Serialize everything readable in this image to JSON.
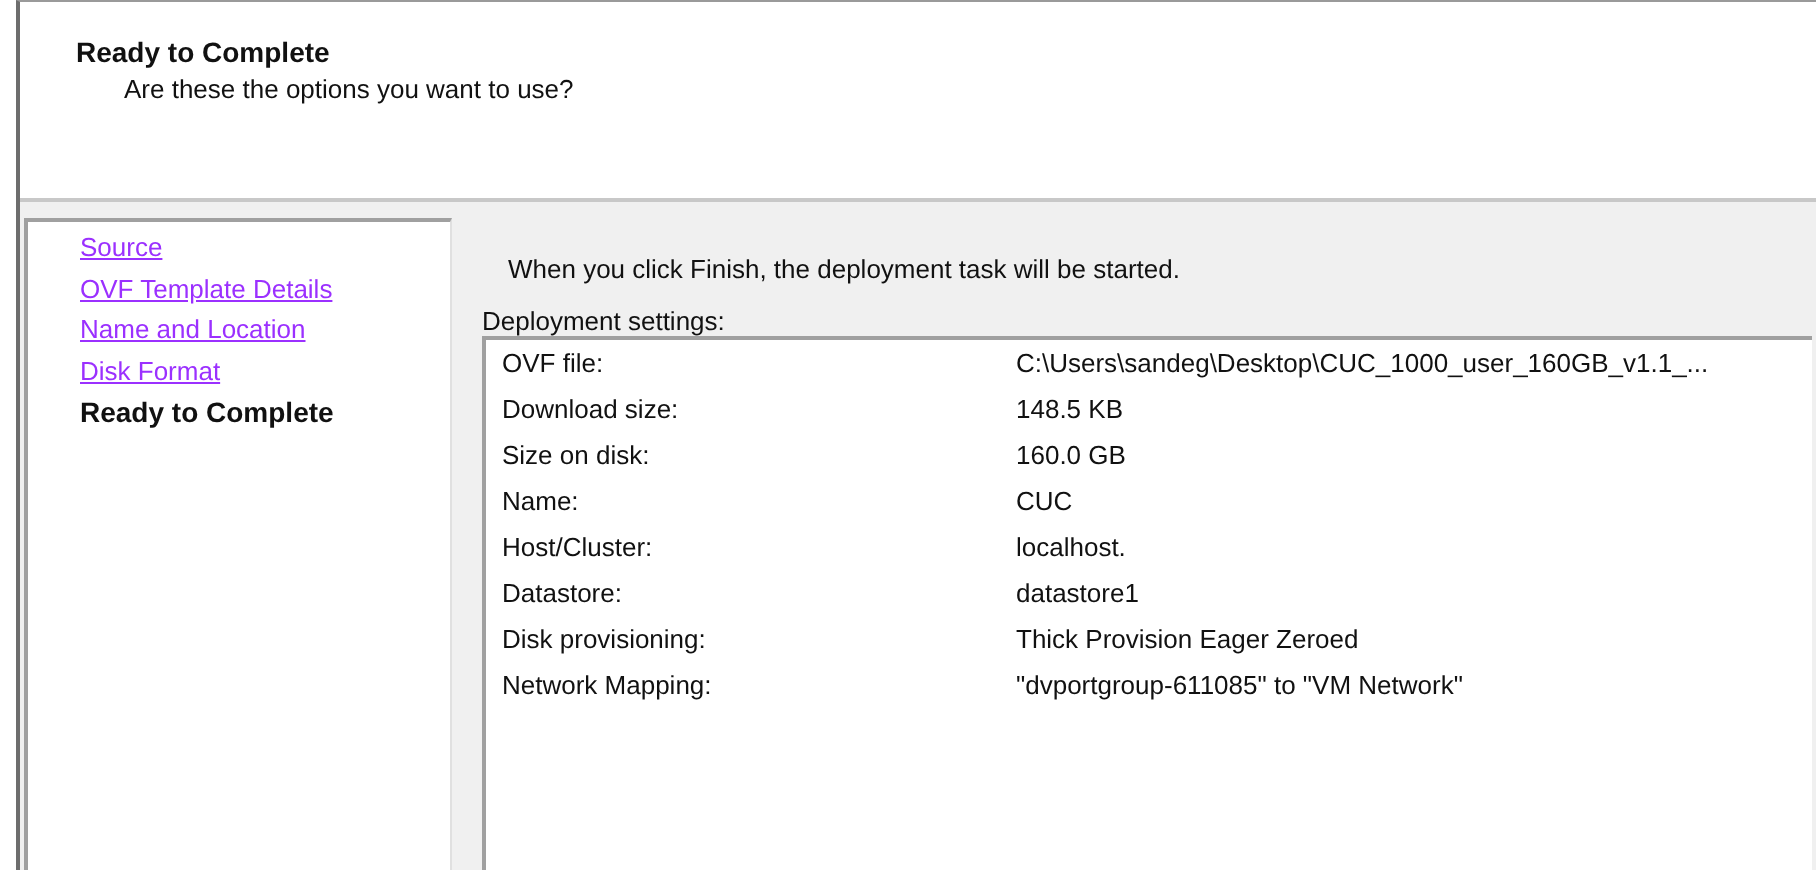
{
  "header": {
    "title": "Ready to Complete",
    "subtitle": "Are these the options you want to use?"
  },
  "steps": [
    {
      "label": "Source",
      "selected": false
    },
    {
      "label": "OVF Template Details",
      "selected": false
    },
    {
      "label": "Name and Location",
      "selected": false
    },
    {
      "label": "Disk Format",
      "selected": false
    },
    {
      "label": "Ready to Complete",
      "selected": true
    }
  ],
  "intro": "When you click Finish, the deployment task will be started.",
  "settings": {
    "label": "Deployment settings:",
    "rows": [
      {
        "name": "OVF file:",
        "value": "C:\\Users\\sandeg\\Desktop\\CUC_1000_user_160GB_v1.1_..."
      },
      {
        "name": "Download size:",
        "value": "148.5 KB"
      },
      {
        "name": "Size on disk:",
        "value": "160.0 GB"
      },
      {
        "name": "Name:",
        "value": "CUC"
      },
      {
        "name": "Host/Cluster:",
        "value": "localhost."
      },
      {
        "name": "Datastore:",
        "value": "datastore1"
      },
      {
        "name": "Disk provisioning:",
        "value": "Thick Provision Eager Zeroed"
      },
      {
        "name": "Network Mapping:",
        "value": "\"dvportgroup-611085\" to \"VM Network\""
      }
    ]
  }
}
